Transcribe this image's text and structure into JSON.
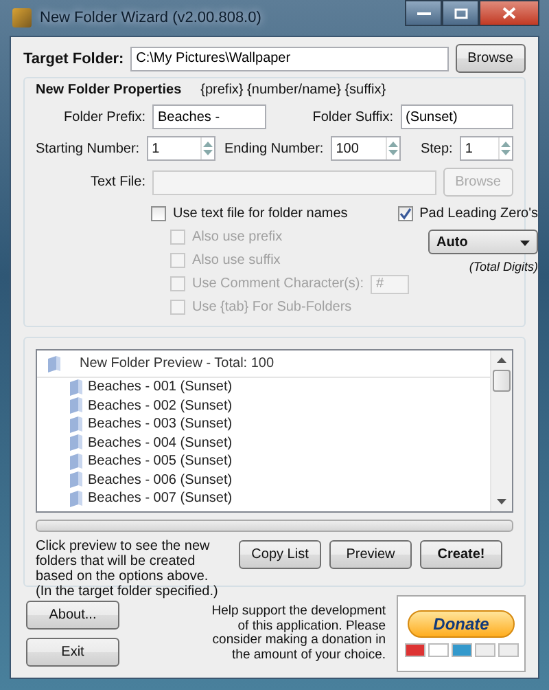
{
  "window": {
    "title": "New Folder Wizard  (v2.00.808.0)"
  },
  "target": {
    "label": "Target Folder:",
    "value": "C:\\My Pictures\\Wallpaper",
    "browse": "Browse"
  },
  "properties": {
    "title": "New Folder Properties",
    "pattern": "{prefix} {number/name} {suffix}",
    "prefix": {
      "label": "Folder Prefix:",
      "value": "Beaches -"
    },
    "suffix": {
      "label": "Folder Suffix:",
      "value": "(Sunset)"
    },
    "spinners": [
      {
        "label": "Starting Number:",
        "value": "1"
      },
      {
        "label": "Ending Number:",
        "value": "100"
      },
      {
        "label": "Step:",
        "value": "1"
      }
    ],
    "text_file": {
      "label": "Text File:",
      "browse": "Browse",
      "disabled": true
    },
    "options": [
      {
        "label": "Use text file for folder names",
        "checked": false,
        "disabled": false
      },
      {
        "label": "Also use prefix",
        "checked": false,
        "disabled": true
      },
      {
        "label": "Also use suffix",
        "checked": false,
        "disabled": true
      },
      {
        "label": "Use Comment Character(s):",
        "checked": false,
        "disabled": true,
        "field": "#"
      },
      {
        "label": "Use {tab} For Sub-Folders",
        "checked": false,
        "disabled": true
      }
    ],
    "pad": {
      "label": "Pad Leading Zero's",
      "checked": true
    },
    "digits": {
      "value": "Auto",
      "caption": "(Total Digits)"
    }
  },
  "preview": {
    "header": "New Folder Preview - Total: 100",
    "rows": [
      "Beaches - 001 (Sunset)",
      "Beaches - 002 (Sunset)",
      "Beaches - 003 (Sunset)",
      "Beaches - 004 (Sunset)",
      "Beaches - 005 (Sunset)",
      "Beaches - 006 (Sunset)",
      "Beaches - 007 (Sunset)"
    ],
    "progress": {
      "level": 0
    },
    "hint": "Click preview to see the new folders that will be created based on the options above. (In the target folder specified.)",
    "buttons": [
      {
        "label": "Copy List",
        "kind": "normal"
      },
      {
        "label": "Preview",
        "kind": "normal"
      },
      {
        "label": "Create!",
        "kind": "primary"
      }
    ]
  },
  "footer": {
    "buttons": [
      "About...",
      "Exit"
    ],
    "support": "Help support the development of this application. Please consider making a donation in the amount of your choice.",
    "donate": "Donate"
  }
}
